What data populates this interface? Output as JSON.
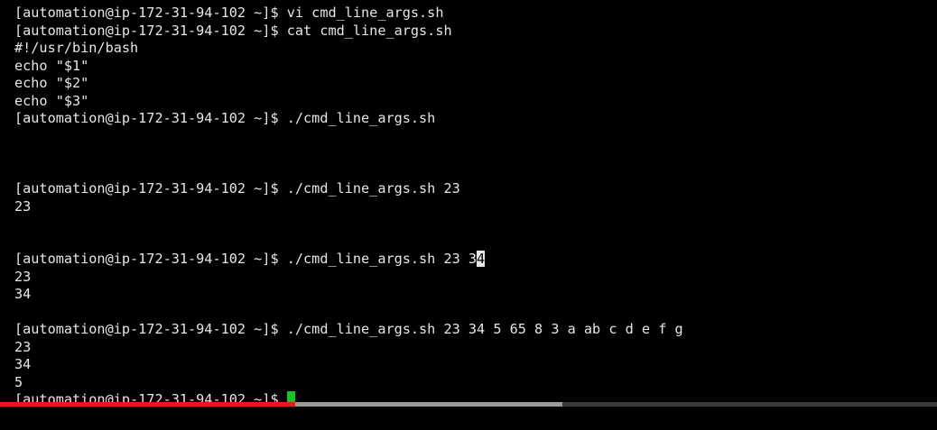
{
  "terminal": {
    "background": "#000000",
    "foreground": "#e6e6e6",
    "cursor_color": "#1fbf2a",
    "lines": [
      "[automation@ip-172-31-94-102 ~]$ vi cmd_line_args.sh",
      "[automation@ip-172-31-94-102 ~]$ cat cmd_line_args.sh",
      "#!/usr/bin/bash",
      "echo \"$1\"",
      "echo \"$2\"",
      "echo \"$3\"",
      "[automation@ip-172-31-94-102 ~]$ ./cmd_line_args.sh",
      "",
      "",
      "",
      "[automation@ip-172-31-94-102 ~]$ ./cmd_line_args.sh 23",
      "23",
      "",
      "",
      "",
      "23",
      "34",
      "",
      "[automation@ip-172-31-94-102 ~]$ ./cmd_line_args.sh 23 34 5 65 8 3 a ab c d e f g",
      "23",
      "34",
      "5",
      ""
    ],
    "selection_line": {
      "before": "[automation@ip-172-31-94-102 ~]$ ./cmd_line_args.sh 23 3",
      "selected": "4"
    },
    "prompt_line": "[automation@ip-172-31-94-102 ~]$ "
  },
  "video_player": {
    "played_fraction": 0.315,
    "buffered_fraction": 0.6,
    "played_color": "#e21b1b",
    "buffered_color": "#9a9a9a",
    "track_color": "#3a3a3a"
  }
}
